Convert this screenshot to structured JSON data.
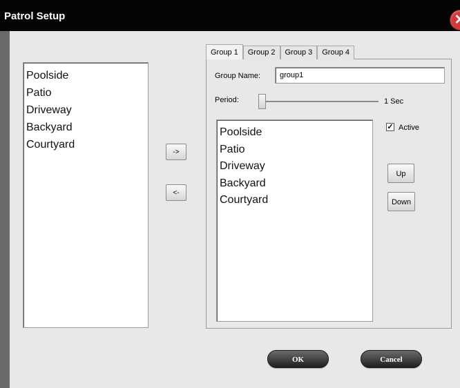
{
  "dialog": {
    "title": "Patrol Setup",
    "close_glyph": "✕"
  },
  "available_list": {
    "items": [
      "Poolside",
      "Patio",
      "Driveway",
      "Backyard",
      "Courtyard"
    ]
  },
  "transfer": {
    "add_label": "->",
    "remove_label": "<-"
  },
  "tabs": [
    {
      "label": "Group 1",
      "active": true
    },
    {
      "label": "Group 2",
      "active": false
    },
    {
      "label": "Group 3",
      "active": false
    },
    {
      "label": "Group 4",
      "active": false
    }
  ],
  "group_form": {
    "name_label": "Group Name:",
    "name_value": "group1",
    "period_label": "Period:",
    "period_value": "1 Sec",
    "active_label": "Active",
    "active_checked": true,
    "check_glyph": "✓"
  },
  "group_list": {
    "items": [
      "Poolside",
      "Patio",
      "Driveway",
      "Backyard",
      "Courtyard"
    ]
  },
  "order_buttons": {
    "up_label": "Up",
    "down_label": "Down"
  },
  "footer": {
    "ok_label": "OK",
    "cancel_label": "Cancel"
  },
  "colors": {
    "titlebar": "#050505",
    "content_bg": "#e8e8e8",
    "close_red": "#d03a3a"
  }
}
